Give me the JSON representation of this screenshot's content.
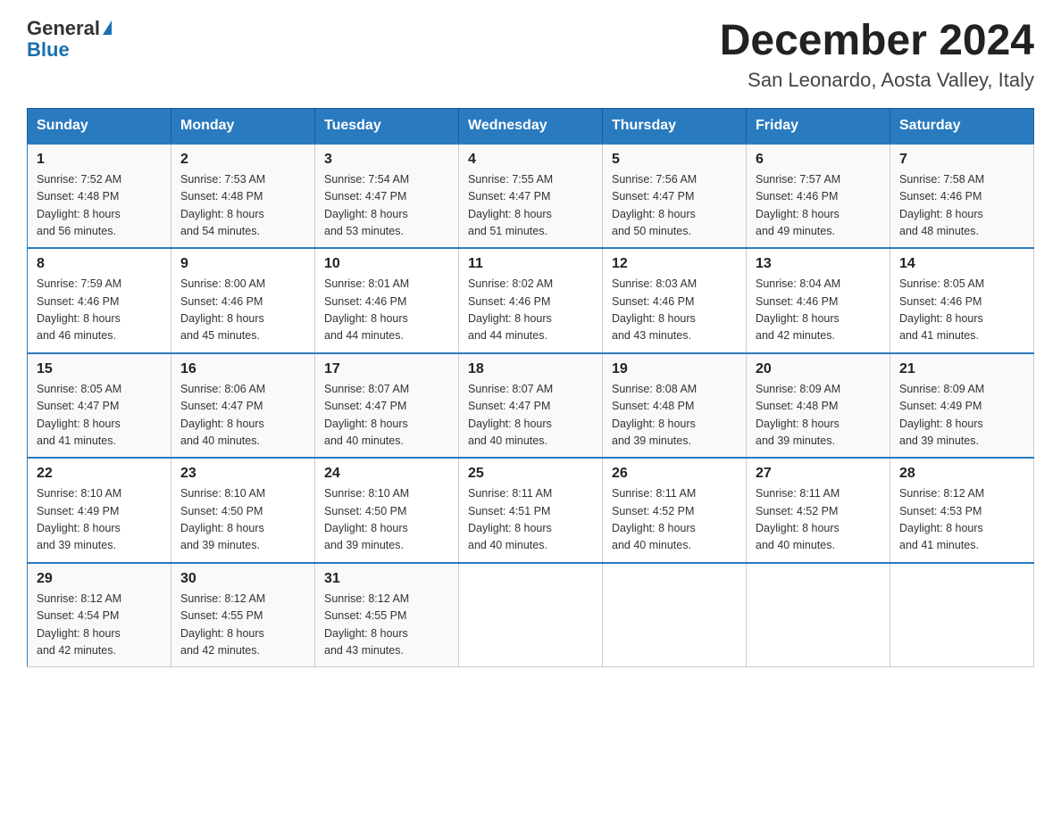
{
  "header": {
    "logo_line1": "General",
    "logo_line2": "Blue",
    "title": "December 2024",
    "subtitle": "San Leonardo, Aosta Valley, Italy"
  },
  "days_of_week": [
    "Sunday",
    "Monday",
    "Tuesday",
    "Wednesday",
    "Thursday",
    "Friday",
    "Saturday"
  ],
  "weeks": [
    [
      {
        "num": "1",
        "sunrise": "7:52 AM",
        "sunset": "4:48 PM",
        "daylight": "8 hours and 56 minutes."
      },
      {
        "num": "2",
        "sunrise": "7:53 AM",
        "sunset": "4:48 PM",
        "daylight": "8 hours and 54 minutes."
      },
      {
        "num": "3",
        "sunrise": "7:54 AM",
        "sunset": "4:47 PM",
        "daylight": "8 hours and 53 minutes."
      },
      {
        "num": "4",
        "sunrise": "7:55 AM",
        "sunset": "4:47 PM",
        "daylight": "8 hours and 51 minutes."
      },
      {
        "num": "5",
        "sunrise": "7:56 AM",
        "sunset": "4:47 PM",
        "daylight": "8 hours and 50 minutes."
      },
      {
        "num": "6",
        "sunrise": "7:57 AM",
        "sunset": "4:46 PM",
        "daylight": "8 hours and 49 minutes."
      },
      {
        "num": "7",
        "sunrise": "7:58 AM",
        "sunset": "4:46 PM",
        "daylight": "8 hours and 48 minutes."
      }
    ],
    [
      {
        "num": "8",
        "sunrise": "7:59 AM",
        "sunset": "4:46 PM",
        "daylight": "8 hours and 46 minutes."
      },
      {
        "num": "9",
        "sunrise": "8:00 AM",
        "sunset": "4:46 PM",
        "daylight": "8 hours and 45 minutes."
      },
      {
        "num": "10",
        "sunrise": "8:01 AM",
        "sunset": "4:46 PM",
        "daylight": "8 hours and 44 minutes."
      },
      {
        "num": "11",
        "sunrise": "8:02 AM",
        "sunset": "4:46 PM",
        "daylight": "8 hours and 44 minutes."
      },
      {
        "num": "12",
        "sunrise": "8:03 AM",
        "sunset": "4:46 PM",
        "daylight": "8 hours and 43 minutes."
      },
      {
        "num": "13",
        "sunrise": "8:04 AM",
        "sunset": "4:46 PM",
        "daylight": "8 hours and 42 minutes."
      },
      {
        "num": "14",
        "sunrise": "8:05 AM",
        "sunset": "4:46 PM",
        "daylight": "8 hours and 41 minutes."
      }
    ],
    [
      {
        "num": "15",
        "sunrise": "8:05 AM",
        "sunset": "4:47 PM",
        "daylight": "8 hours and 41 minutes."
      },
      {
        "num": "16",
        "sunrise": "8:06 AM",
        "sunset": "4:47 PM",
        "daylight": "8 hours and 40 minutes."
      },
      {
        "num": "17",
        "sunrise": "8:07 AM",
        "sunset": "4:47 PM",
        "daylight": "8 hours and 40 minutes."
      },
      {
        "num": "18",
        "sunrise": "8:07 AM",
        "sunset": "4:47 PM",
        "daylight": "8 hours and 40 minutes."
      },
      {
        "num": "19",
        "sunrise": "8:08 AM",
        "sunset": "4:48 PM",
        "daylight": "8 hours and 39 minutes."
      },
      {
        "num": "20",
        "sunrise": "8:09 AM",
        "sunset": "4:48 PM",
        "daylight": "8 hours and 39 minutes."
      },
      {
        "num": "21",
        "sunrise": "8:09 AM",
        "sunset": "4:49 PM",
        "daylight": "8 hours and 39 minutes."
      }
    ],
    [
      {
        "num": "22",
        "sunrise": "8:10 AM",
        "sunset": "4:49 PM",
        "daylight": "8 hours and 39 minutes."
      },
      {
        "num": "23",
        "sunrise": "8:10 AM",
        "sunset": "4:50 PM",
        "daylight": "8 hours and 39 minutes."
      },
      {
        "num": "24",
        "sunrise": "8:10 AM",
        "sunset": "4:50 PM",
        "daylight": "8 hours and 39 minutes."
      },
      {
        "num": "25",
        "sunrise": "8:11 AM",
        "sunset": "4:51 PM",
        "daylight": "8 hours and 40 minutes."
      },
      {
        "num": "26",
        "sunrise": "8:11 AM",
        "sunset": "4:52 PM",
        "daylight": "8 hours and 40 minutes."
      },
      {
        "num": "27",
        "sunrise": "8:11 AM",
        "sunset": "4:52 PM",
        "daylight": "8 hours and 40 minutes."
      },
      {
        "num": "28",
        "sunrise": "8:12 AM",
        "sunset": "4:53 PM",
        "daylight": "8 hours and 41 minutes."
      }
    ],
    [
      {
        "num": "29",
        "sunrise": "8:12 AM",
        "sunset": "4:54 PM",
        "daylight": "8 hours and 42 minutes."
      },
      {
        "num": "30",
        "sunrise": "8:12 AM",
        "sunset": "4:55 PM",
        "daylight": "8 hours and 42 minutes."
      },
      {
        "num": "31",
        "sunrise": "8:12 AM",
        "sunset": "4:55 PM",
        "daylight": "8 hours and 43 minutes."
      },
      null,
      null,
      null,
      null
    ]
  ],
  "labels": {
    "sunrise": "Sunrise:",
    "sunset": "Sunset:",
    "daylight": "Daylight:"
  }
}
